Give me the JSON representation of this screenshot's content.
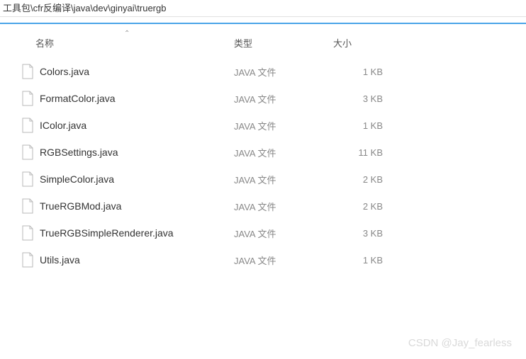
{
  "path": "工具包\\cfr反编译\\java\\dev\\ginyai\\truergb",
  "headers": {
    "name": "名称",
    "type": "类型",
    "size": "大小"
  },
  "sort_indicator": "⌃",
  "files": [
    {
      "name": "Colors.java",
      "type": "JAVA 文件",
      "size": "1 KB"
    },
    {
      "name": "FormatColor.java",
      "type": "JAVA 文件",
      "size": "3 KB"
    },
    {
      "name": "IColor.java",
      "type": "JAVA 文件",
      "size": "1 KB"
    },
    {
      "name": "RGBSettings.java",
      "type": "JAVA 文件",
      "size": "11 KB"
    },
    {
      "name": "SimpleColor.java",
      "type": "JAVA 文件",
      "size": "2 KB"
    },
    {
      "name": "TrueRGBMod.java",
      "type": "JAVA 文件",
      "size": "2 KB"
    },
    {
      "name": "TrueRGBSimpleRenderer.java",
      "type": "JAVA 文件",
      "size": "3 KB"
    },
    {
      "name": "Utils.java",
      "type": "JAVA 文件",
      "size": "1 KB"
    }
  ],
  "watermark": "CSDN @Jay_fearless"
}
